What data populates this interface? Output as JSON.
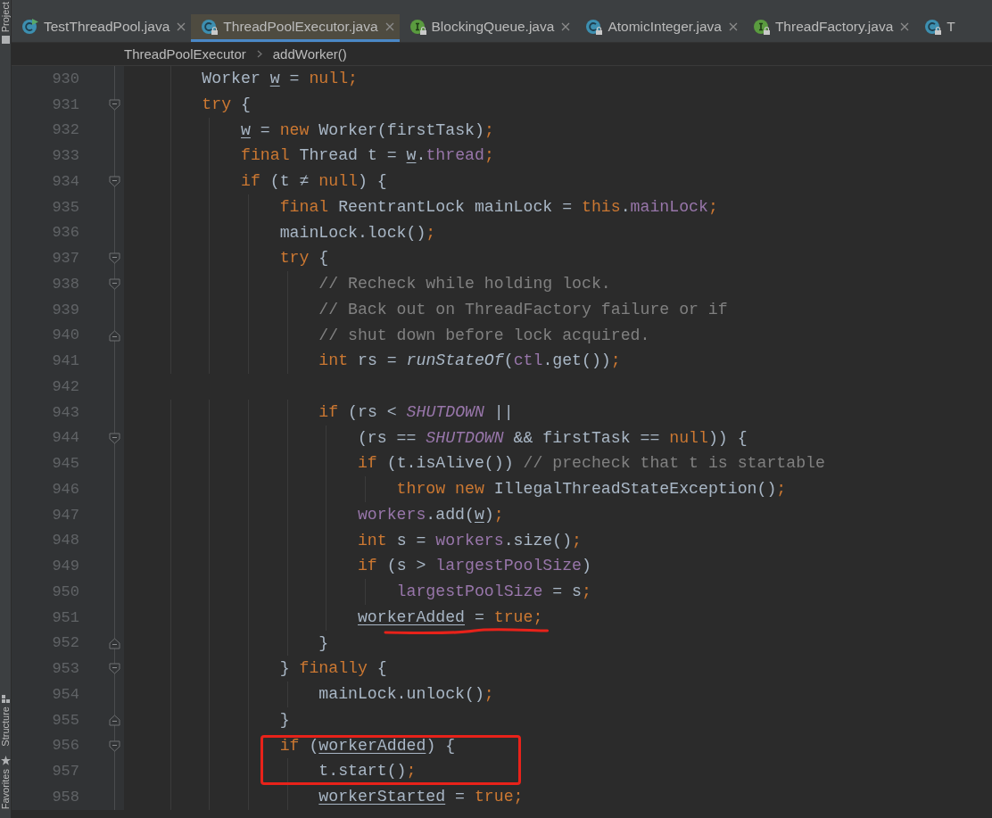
{
  "tool_strip": [
    {
      "label": "Project"
    },
    {
      "label": "Structure"
    },
    {
      "label": "Favorites"
    }
  ],
  "tabs": [
    {
      "label": "TestThreadPool.java",
      "kind": "class",
      "locked": false,
      "runnable": true,
      "selected": false,
      "closable": true
    },
    {
      "label": "ThreadPoolExecutor.java",
      "kind": "class",
      "locked": true,
      "runnable": false,
      "selected": true,
      "closable": true
    },
    {
      "label": "BlockingQueue.java",
      "kind": "interface",
      "locked": true,
      "runnable": false,
      "selected": false,
      "closable": true
    },
    {
      "label": "AtomicInteger.java",
      "kind": "class",
      "locked": true,
      "runnable": false,
      "selected": false,
      "closable": true
    },
    {
      "label": "ThreadFactory.java",
      "kind": "interface",
      "locked": true,
      "runnable": false,
      "selected": false,
      "closable": true
    },
    {
      "label": "T",
      "kind": "class",
      "locked": true,
      "runnable": false,
      "selected": false,
      "closable": false
    }
  ],
  "breadcrumbs": [
    "ThreadPoolExecutor",
    "addWorker()"
  ],
  "code_lines": [
    {
      "number": "930",
      "fold_open": false,
      "fold_close": false,
      "underlined": false,
      "boxed": false,
      "tokens": [
        {
          "t": "        Worker ",
          "kind": "plain"
        },
        {
          "t": "w",
          "kind": "var"
        },
        {
          "t": " = ",
          "kind": "plain"
        },
        {
          "t": "null;",
          "kind": "kw"
        }
      ]
    },
    {
      "number": "931",
      "fold_open": true,
      "fold_close": false,
      "underlined": false,
      "boxed": false,
      "tokens": [
        {
          "t": "        try",
          "kind": "kw"
        },
        {
          "t": " {",
          "kind": "plain"
        }
      ]
    },
    {
      "number": "932",
      "fold_open": false,
      "fold_close": false,
      "underlined": false,
      "boxed": false,
      "tokens": [
        {
          "t": "            w",
          "kind": "var"
        },
        {
          "t": " = ",
          "kind": "plain"
        },
        {
          "t": "new",
          "kind": "kw"
        },
        {
          "t": " Worker(firstTask)",
          "kind": "plain"
        },
        {
          "t": ";",
          "kind": "kw"
        }
      ]
    },
    {
      "number": "933",
      "fold_open": false,
      "fold_close": false,
      "underlined": false,
      "boxed": false,
      "tokens": [
        {
          "t": "            final",
          "kind": "kw"
        },
        {
          "t": " Thread t = ",
          "kind": "plain"
        },
        {
          "t": "w",
          "kind": "var"
        },
        {
          "t": ".",
          "kind": "plain"
        },
        {
          "t": "thread",
          "kind": "field"
        },
        {
          "t": ";",
          "kind": "kw"
        }
      ]
    },
    {
      "number": "934",
      "fold_open": true,
      "fold_close": false,
      "underlined": false,
      "boxed": false,
      "tokens": [
        {
          "t": "            if",
          "kind": "kw"
        },
        {
          "t": " (t ≠ ",
          "kind": "plain"
        },
        {
          "t": "null",
          "kind": "kw"
        },
        {
          "t": ") {",
          "kind": "plain"
        }
      ]
    },
    {
      "number": "935",
      "fold_open": false,
      "fold_close": false,
      "underlined": false,
      "boxed": false,
      "tokens": [
        {
          "t": "                final",
          "kind": "kw"
        },
        {
          "t": " ReentrantLock mainLock = ",
          "kind": "plain"
        },
        {
          "t": "this",
          "kind": "kw"
        },
        {
          "t": ".",
          "kind": "plain"
        },
        {
          "t": "mainLock",
          "kind": "field"
        },
        {
          "t": ";",
          "kind": "kw"
        }
      ]
    },
    {
      "number": "936",
      "fold_open": false,
      "fold_close": false,
      "underlined": false,
      "boxed": false,
      "tokens": [
        {
          "t": "                mainLock.lock()",
          "kind": "plain"
        },
        {
          "t": ";",
          "kind": "kw"
        }
      ]
    },
    {
      "number": "937",
      "fold_open": true,
      "fold_close": false,
      "underlined": false,
      "boxed": false,
      "tokens": [
        {
          "t": "                try",
          "kind": "kw"
        },
        {
          "t": " {",
          "kind": "plain"
        }
      ]
    },
    {
      "number": "938",
      "fold_open": true,
      "fold_close": false,
      "underlined": false,
      "boxed": false,
      "tokens": [
        {
          "t": "                    // Recheck while holding lock.",
          "kind": "comment"
        }
      ]
    },
    {
      "number": "939",
      "fold_open": false,
      "fold_close": false,
      "underlined": false,
      "boxed": false,
      "tokens": [
        {
          "t": "                    // Back out on ThreadFactory failure or if",
          "kind": "comment"
        }
      ]
    },
    {
      "number": "940",
      "fold_open": false,
      "fold_close": true,
      "underlined": false,
      "boxed": false,
      "tokens": [
        {
          "t": "                    // shut down before lock acquired.",
          "kind": "comment"
        }
      ]
    },
    {
      "number": "941",
      "fold_open": false,
      "fold_close": false,
      "underlined": false,
      "boxed": false,
      "tokens": [
        {
          "t": "                    int",
          "kind": "kw"
        },
        {
          "t": " rs = ",
          "kind": "plain"
        },
        {
          "t": "runStateOf",
          "kind": "italic"
        },
        {
          "t": "(",
          "kind": "plain"
        },
        {
          "t": "ctl",
          "kind": "field"
        },
        {
          "t": ".get())",
          "kind": "plain"
        },
        {
          "t": ";",
          "kind": "kw"
        }
      ]
    },
    {
      "number": "942",
      "fold_open": false,
      "fold_close": false
    },
    {
      "number": "943",
      "fold_open": false,
      "fold_close": false,
      "underlined": false,
      "boxed": false,
      "tokens": [
        {
          "t": "                    if",
          "kind": "kw"
        },
        {
          "t": " (rs < ",
          "kind": "plain"
        },
        {
          "t": "SHUTDOWN",
          "kind": "static"
        },
        {
          "t": " ||",
          "kind": "plain"
        }
      ]
    },
    {
      "number": "944",
      "fold_open": true,
      "fold_close": false,
      "underlined": false,
      "boxed": false,
      "tokens": [
        {
          "t": "                        (rs == ",
          "kind": "plain"
        },
        {
          "t": "SHUTDOWN",
          "kind": "static"
        },
        {
          "t": " && firstTask == ",
          "kind": "plain"
        },
        {
          "t": "null",
          "kind": "kw"
        },
        {
          "t": ")) {",
          "kind": "plain"
        }
      ]
    },
    {
      "number": "945",
      "fold_open": false,
      "fold_close": false,
      "underlined": false,
      "boxed": false,
      "tokens": [
        {
          "t": "                        if",
          "kind": "kw"
        },
        {
          "t": " (t.isAlive()) ",
          "kind": "plain"
        },
        {
          "t": "// precheck that t is startable",
          "kind": "comment"
        }
      ]
    },
    {
      "number": "946",
      "fold_open": false,
      "fold_close": false,
      "underlined": false,
      "boxed": false,
      "tokens": [
        {
          "t": "                            throw",
          "kind": "kw"
        },
        {
          "t": " new",
          "kind": "kw"
        },
        {
          "t": " IllegalThreadStateException()",
          "kind": "plain"
        },
        {
          "t": ";",
          "kind": "kw"
        }
      ]
    },
    {
      "number": "947",
      "fold_open": false,
      "fold_close": false,
      "underlined": false,
      "boxed": false,
      "tokens": [
        {
          "t": "                        workers",
          "kind": "field"
        },
        {
          "t": ".add(",
          "kind": "plain"
        },
        {
          "t": "w",
          "kind": "var"
        },
        {
          "t": ")",
          "kind": "plain"
        },
        {
          "t": ";",
          "kind": "kw"
        }
      ]
    },
    {
      "number": "948",
      "fold_open": false,
      "fold_close": false,
      "underlined": false,
      "boxed": false,
      "tokens": [
        {
          "t": "                        int",
          "kind": "kw"
        },
        {
          "t": " s = ",
          "kind": "plain"
        },
        {
          "t": "workers",
          "kind": "field"
        },
        {
          "t": ".size()",
          "kind": "plain"
        },
        {
          "t": ";",
          "kind": "kw"
        }
      ]
    },
    {
      "number": "949",
      "fold_open": false,
      "fold_close": false,
      "underlined": false,
      "boxed": false,
      "tokens": [
        {
          "t": "                        if",
          "kind": "kw"
        },
        {
          "t": " (s > ",
          "kind": "plain"
        },
        {
          "t": "largestPoolSize",
          "kind": "field"
        },
        {
          "t": ")",
          "kind": "plain"
        }
      ]
    },
    {
      "number": "950",
      "fold_open": false,
      "fold_close": false,
      "underlined": false,
      "boxed": false,
      "tokens": [
        {
          "t": "                            largestPoolSize",
          "kind": "field"
        },
        {
          "t": " = s",
          "kind": "plain"
        },
        {
          "t": ";",
          "kind": "kw"
        }
      ]
    },
    {
      "number": "951",
      "fold_open": false,
      "fold_close": false,
      "underlined": true,
      "boxed": false,
      "tokens": [
        {
          "t": "                        workerAdded",
          "kind": "var"
        },
        {
          "t": " = ",
          "kind": "plain"
        },
        {
          "t": "true;",
          "kind": "kw"
        }
      ]
    },
    {
      "number": "952",
      "fold_open": false,
      "fold_close": true,
      "underlined": false,
      "boxed": false,
      "tokens": [
        {
          "t": "                    }",
          "kind": "plain"
        }
      ]
    },
    {
      "number": "953",
      "fold_open": true,
      "fold_close": false,
      "underlined": false,
      "boxed": false,
      "tokens": [
        {
          "t": "                } ",
          "kind": "plain"
        },
        {
          "t": "finally",
          "kind": "kw"
        },
        {
          "t": " {",
          "kind": "plain"
        }
      ]
    },
    {
      "number": "954",
      "fold_open": false,
      "fold_close": false,
      "underlined": false,
      "boxed": false,
      "tokens": [
        {
          "t": "                    mainLock.unlock()",
          "kind": "plain"
        },
        {
          "t": ";",
          "kind": "kw"
        }
      ]
    },
    {
      "number": "955",
      "fold_open": false,
      "fold_close": true,
      "underlined": false,
      "boxed": false,
      "tokens": [
        {
          "t": "                }",
          "kind": "plain"
        }
      ]
    },
    {
      "number": "956",
      "fold_open": true,
      "fold_close": false,
      "underlined": false,
      "boxed": true,
      "tokens": [
        {
          "t": "                if",
          "kind": "kw"
        },
        {
          "t": " (",
          "kind": "plain"
        },
        {
          "t": "workerAdded",
          "kind": "var"
        },
        {
          "t": ") {",
          "kind": "plain"
        }
      ]
    },
    {
      "number": "957",
      "fold_open": false,
      "fold_close": false,
      "underlined": false,
      "boxed": true,
      "tokens": [
        {
          "t": "                    t.start()",
          "kind": "plain"
        },
        {
          "t": ";",
          "kind": "kw"
        }
      ]
    },
    {
      "number": "958",
      "fold_open": false,
      "fold_close": false,
      "underlined": false,
      "boxed": false,
      "tokens": [
        {
          "t": "                    workerStarted",
          "kind": "var"
        },
        {
          "t": " = ",
          "kind": "plain"
        },
        {
          "t": "true;",
          "kind": "kw"
        }
      ]
    }
  ]
}
